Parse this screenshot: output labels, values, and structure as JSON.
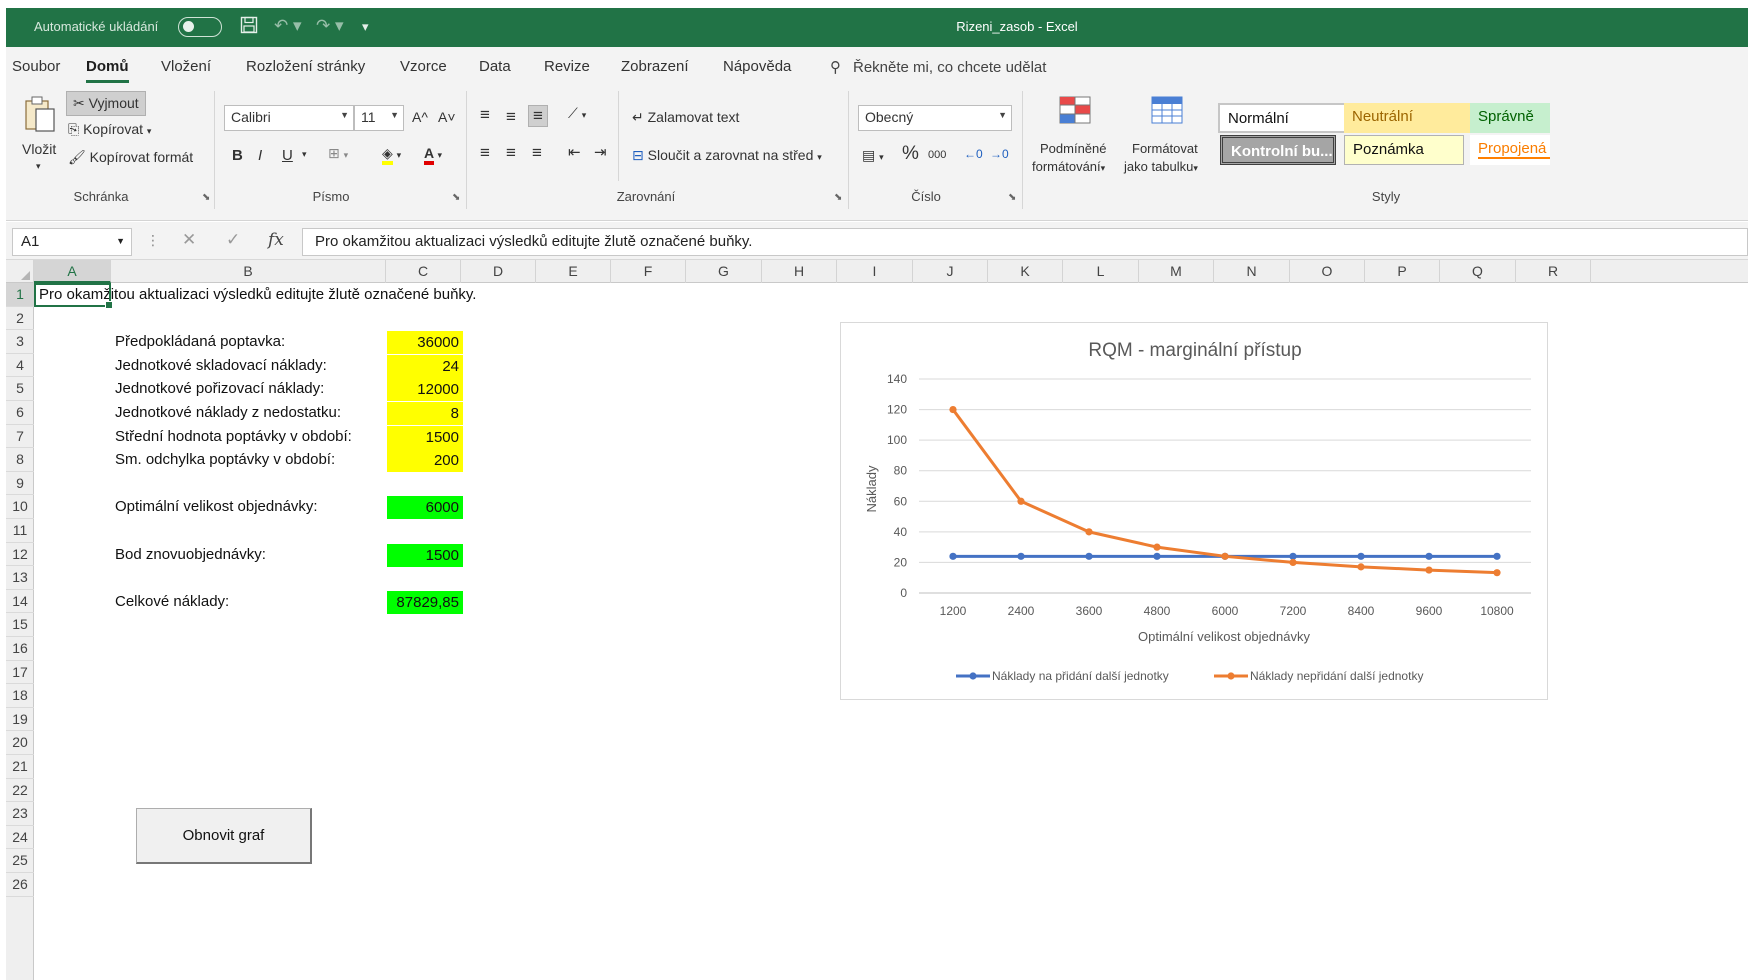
{
  "titlebar": {
    "autosave_label": "Automatické ukládání",
    "doc_title": "Rizeni_zasob  -  Excel"
  },
  "menu": {
    "tabs": [
      "Soubor",
      "Domů",
      "Vložení",
      "Rozložení stránky",
      "Vzorce",
      "Data",
      "Revize",
      "Zobrazení",
      "Nápověda"
    ],
    "active_tab": "Domů",
    "tell_me": "Řekněte mi, co chcete udělat"
  },
  "ribbon": {
    "clipboard": {
      "paste": "Vložit",
      "cut": "Vyjmout",
      "copy": "Kopírovat",
      "format_painter": "Kopírovat formát",
      "group_label": "Schránka"
    },
    "font": {
      "font_name": "Calibri",
      "font_size": "11",
      "grow": "A^",
      "shrink": "A˅",
      "bold": "B",
      "italic": "I",
      "underline": "U",
      "group_label": "Písmo"
    },
    "alignment": {
      "wrap_text": "Zalamovat text",
      "merge_center": "Sloučit a zarovnat na střed",
      "group_label": "Zarovnání"
    },
    "number": {
      "format": "Obecný",
      "percent": "%",
      "thousands": "000",
      "group_label": "Číslo"
    },
    "styles": {
      "conditional_1": "Podmíněné",
      "conditional_2": "formátování",
      "as_table_1": "Formátovat",
      "as_table_2": "jako tabulku",
      "normal": "Normální",
      "neutral": "Neutrální",
      "good": "Správně",
      "check_cell": "Kontrolní bu...",
      "note": "Poznámka",
      "linked": "Propojená b...",
      "group_label": "Styly"
    }
  },
  "formula_bar": {
    "name_box": "A1",
    "fx": "fx",
    "content": "Pro okamžitou aktualizaci výsledků editujte žlutě označené buňky."
  },
  "sheet": {
    "columns": [
      "A",
      "B",
      "C",
      "D",
      "E",
      "F",
      "G",
      "H",
      "I",
      "J",
      "K",
      "L",
      "M",
      "N",
      "O",
      "P",
      "Q",
      "R"
    ],
    "rows": [
      "1",
      "2",
      "3",
      "4",
      "5",
      "6",
      "7",
      "8",
      "9",
      "10",
      "11",
      "12",
      "13",
      "14",
      "15",
      "16",
      "17",
      "18",
      "19",
      "20",
      "21",
      "22",
      "23",
      "24",
      "25",
      "26"
    ],
    "a1": "Pro okamžitou aktualizaci výsledků editujte žlutě označené buňky.",
    "inputs": [
      {
        "label": "Předpokládaná poptavka:",
        "value": "36000"
      },
      {
        "label": "Jednotkové skladovací náklady:",
        "value": "24"
      },
      {
        "label": "Jednotkové pořizovací náklady:",
        "value": "12000"
      },
      {
        "label": "Jednotkové náklady z nedostatku:",
        "value": "8"
      },
      {
        "label": "Střední hodnota poptávky v období:",
        "value": "1500"
      },
      {
        "label": "Sm. odchylka poptávky v období:",
        "value": "200"
      }
    ],
    "outputs": [
      {
        "label": "Optimální velikost objednávky:",
        "value": "6000"
      },
      {
        "label": "Bod znovuobjednávky:",
        "value": "1500"
      },
      {
        "label": "Celkové náklady:",
        "value": "87829,85"
      }
    ],
    "refresh_button": "Obnovit graf"
  },
  "colors": {
    "excel_green": "#217346",
    "input_fill": "#ffff00",
    "output_fill": "#00ff00",
    "series_blue": "#4472c4",
    "series_orange": "#ed7d31"
  },
  "chart_data": {
    "type": "line",
    "title": "RQM - marginální přístup",
    "xlabel": "Optimální velikost objednávky",
    "ylabel": "Náklady",
    "categories": [
      "1200",
      "2400",
      "3600",
      "4800",
      "6000",
      "7200",
      "8400",
      "9600",
      "10800"
    ],
    "ylim": [
      0,
      140
    ],
    "yticks": [
      0,
      20,
      40,
      60,
      80,
      100,
      120,
      140
    ],
    "grid": true,
    "legend": "bottom",
    "series": [
      {
        "name": "Náklady na přidání další jednotky",
        "values": [
          24,
          24,
          24,
          24,
          24,
          24,
          24,
          24,
          24
        ],
        "color": "#4472c4"
      },
      {
        "name": "Náklady nepřidání další jednotky",
        "values": [
          120,
          60,
          40,
          30,
          24,
          20,
          17.1,
          15,
          13.3
        ],
        "color": "#ed7d31"
      }
    ]
  }
}
